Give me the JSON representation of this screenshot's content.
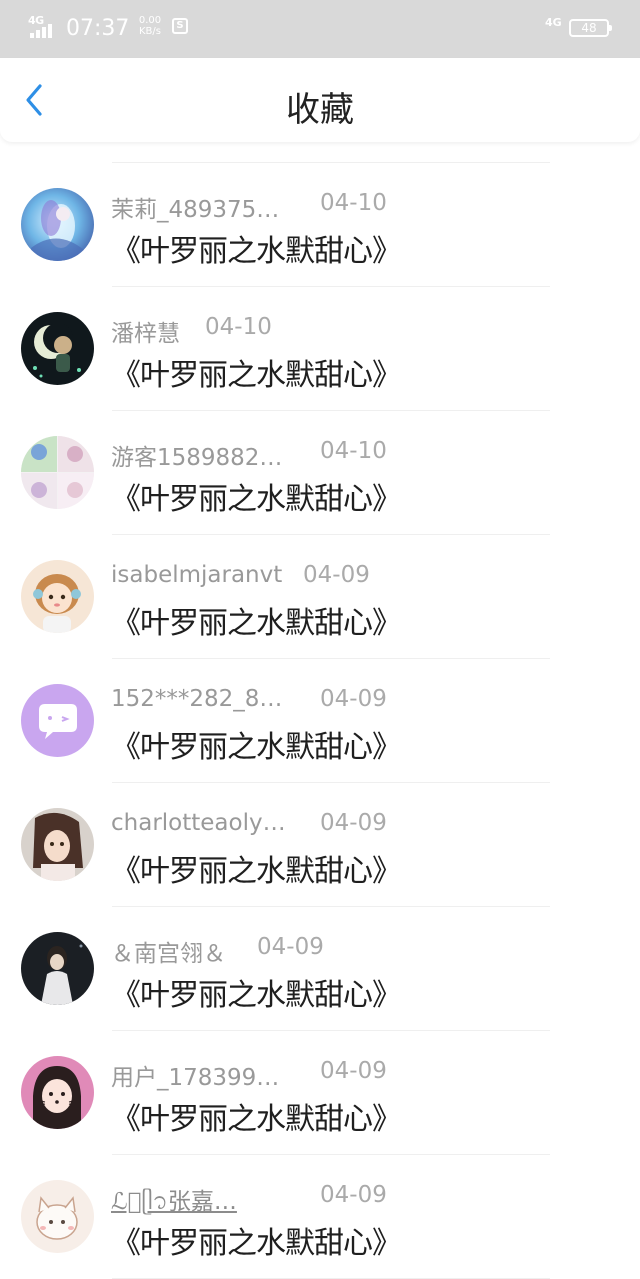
{
  "status_bar": {
    "network_left": "4G",
    "time": "07:37",
    "speed_value": "0.00",
    "speed_unit": "KB/s",
    "network_right": "4G",
    "battery": "48"
  },
  "header": {
    "title": "收藏"
  },
  "favorites": [
    {
      "username": "茉莉_489375…",
      "date": "04-10",
      "title": "《叶罗丽之水默甜心》",
      "avatar": "anime-blue-fairy"
    },
    {
      "username": "潘梓慧",
      "date": "04-10",
      "title": "《叶罗丽之水默甜心》",
      "avatar": "moon-night"
    },
    {
      "username": "游客1589882…",
      "date": "04-10",
      "title": "《叶罗丽之水默甜心》",
      "avatar": "collage"
    },
    {
      "username": "isabelmjaranvt",
      "date": "04-09",
      "title": "《叶罗丽之水默甜心》",
      "avatar": "doll-girl"
    },
    {
      "username": "152***282_8…",
      "date": "04-09",
      "title": "《叶罗丽之水默甜心》",
      "avatar": "chat-bubble"
    },
    {
      "username": "charlotteaoly…",
      "date": "04-09",
      "title": "《叶罗丽之水默甜心》",
      "avatar": "doll-portrait"
    },
    {
      "username": "＆南宫翎＆",
      "date": "04-09",
      "title": "《叶罗丽之水默甜心》",
      "avatar": "dark-portrait"
    },
    {
      "username": "用户_178399…",
      "date": "04-09",
      "title": "《叶罗丽之水默甜心》",
      "avatar": "cat-filter-girl"
    },
    {
      "username": "ℒ᭄ᥫ᭡张嘉…",
      "date": "04-09",
      "title": "《叶罗丽之水默甜心》",
      "avatar": "sketch-cat"
    }
  ]
}
